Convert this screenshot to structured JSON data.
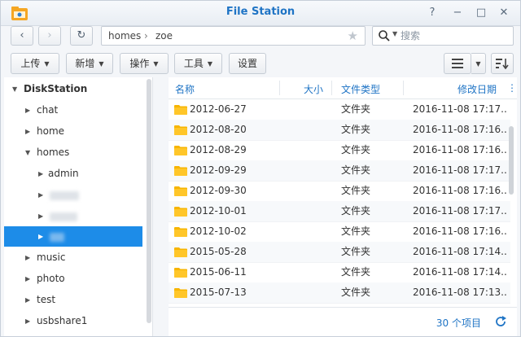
{
  "window": {
    "title": "File Station"
  },
  "titlebar": {
    "help": "?",
    "minimize": "−",
    "maximize": "□",
    "close": "✕"
  },
  "nav": {
    "back": "‹",
    "forward": "›",
    "refresh": "↻",
    "breadcrumb": [
      "homes",
      "zoe"
    ],
    "breadcrumb_sep": "›",
    "search_placeholder": "搜索"
  },
  "toolbar": {
    "upload": "上传",
    "create": "新增",
    "action": "操作",
    "tools": "工具",
    "settings": "设置"
  },
  "sidebar": {
    "root": "DiskStation",
    "items": [
      {
        "label": "chat"
      },
      {
        "label": "home"
      },
      {
        "label": "homes"
      },
      {
        "label": "admin"
      },
      {
        "label": ""
      },
      {
        "label": ""
      },
      {
        "label": ""
      },
      {
        "label": "music"
      },
      {
        "label": "photo"
      },
      {
        "label": "test"
      },
      {
        "label": "usbshare1"
      }
    ]
  },
  "list": {
    "columns": {
      "name": "名称",
      "size": "大小",
      "type": "文件类型",
      "modified": "修改日期"
    },
    "rows": [
      {
        "name": "2012-06-27",
        "type": "文件夹",
        "modified": "2016-11-08 17:17..."
      },
      {
        "name": "2012-08-20",
        "type": "文件夹",
        "modified": "2016-11-08 17:16..."
      },
      {
        "name": "2012-08-29",
        "type": "文件夹",
        "modified": "2016-11-08 17:16..."
      },
      {
        "name": "2012-09-29",
        "type": "文件夹",
        "modified": "2016-11-08 17:17..."
      },
      {
        "name": "2012-09-30",
        "type": "文件夹",
        "modified": "2016-11-08 17:16..."
      },
      {
        "name": "2012-10-01",
        "type": "文件夹",
        "modified": "2016-11-08 17:17..."
      },
      {
        "name": "2012-10-02",
        "type": "文件夹",
        "modified": "2016-11-08 17:16..."
      },
      {
        "name": "2015-05-28",
        "type": "文件夹",
        "modified": "2016-11-08 17:14..."
      },
      {
        "name": "2015-06-11",
        "type": "文件夹",
        "modified": "2016-11-08 17:14..."
      },
      {
        "name": "2015-07-13",
        "type": "文件夹",
        "modified": "2016-11-08 17:13..."
      }
    ],
    "item_count": "30 个项目"
  },
  "colors": {
    "accent": "#1f74c5",
    "selection": "#1d8ce8",
    "folder": "#f7b500"
  }
}
